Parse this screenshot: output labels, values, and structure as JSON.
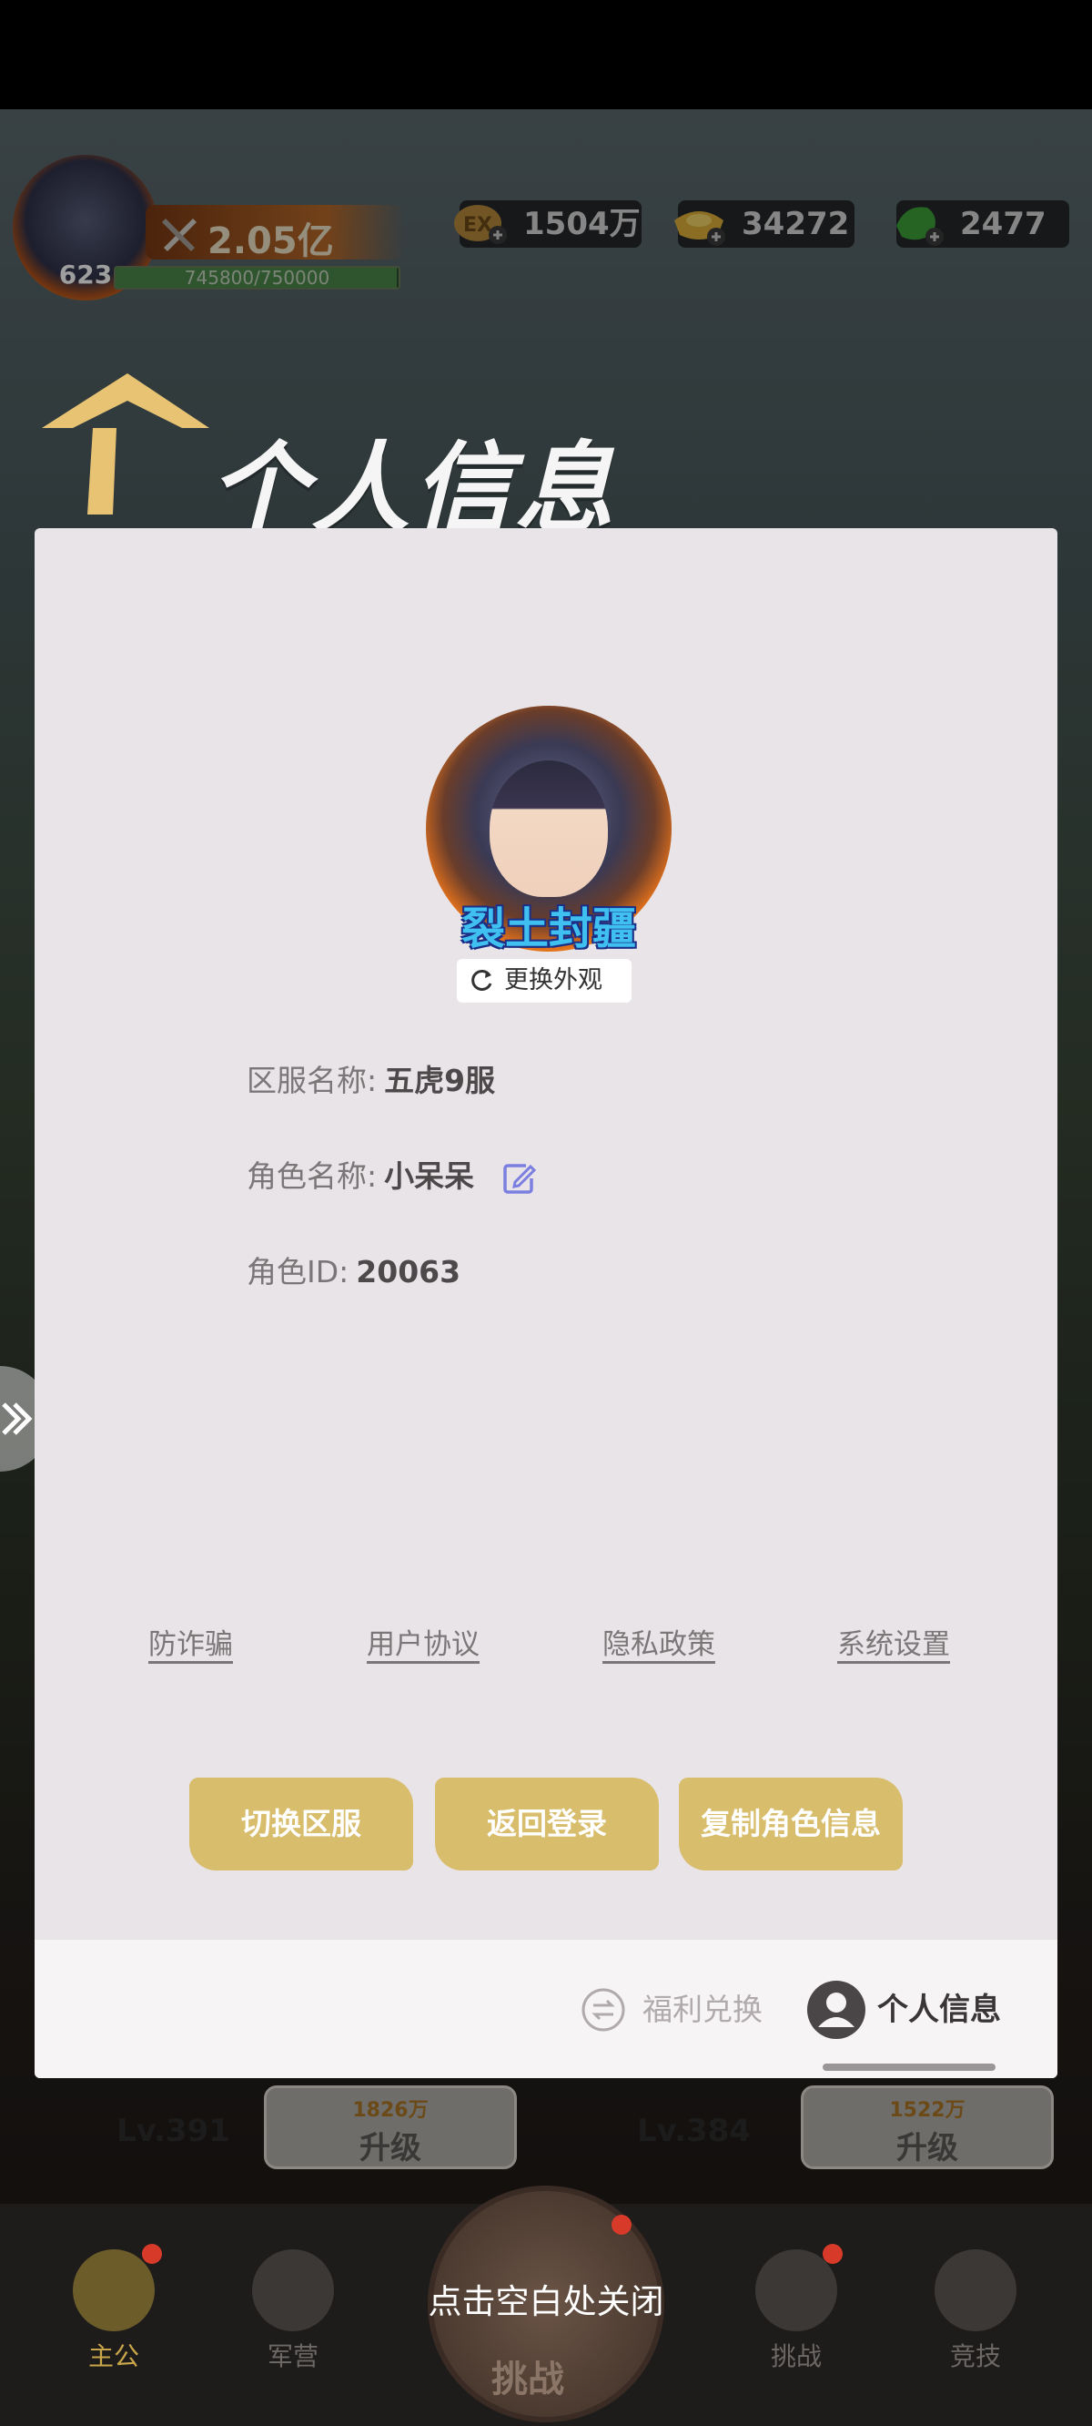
{
  "hud": {
    "player_level": "623",
    "power": "2.05亿",
    "exp_text": "745800/750000",
    "exp_fraction": 0.9944,
    "resources": [
      {
        "icon": "exp-coin-icon",
        "value": "1504万"
      },
      {
        "icon": "gold-ingot-icon",
        "value": "34272"
      },
      {
        "icon": "jade-icon",
        "value": "2477"
      }
    ]
  },
  "page_title": "个人信息",
  "profile": {
    "avatar_title": "裂土封疆",
    "change_skin_label": "更换外观",
    "server_label": "区服名称:",
    "server_value": "五虎9服",
    "role_name_label": "角色名称:",
    "role_name_value": "小呆呆",
    "role_id_label": "角色ID:",
    "role_id_value": "20063"
  },
  "links": {
    "anti_fraud": "防诈骗",
    "user_agreement": "用户协议",
    "privacy_policy": "隐私政策",
    "system_settings": "系统设置"
  },
  "buttons": {
    "switch_server": "切换区服",
    "back_to_login": "返回登录",
    "copy_role_info": "复制角色信息"
  },
  "tabs": {
    "welfare_exchange": "福利兑换",
    "personal_info": "个人信息"
  },
  "background": {
    "hero_cards": [
      {
        "level": "Lv.391",
        "upgrade_cost": "1826万",
        "upgrade_label": "升级"
      },
      {
        "level": "Lv.384",
        "upgrade_cost": "1522万",
        "upgrade_label": "升级"
      }
    ],
    "nav": [
      "主公",
      "军营",
      "挑战",
      "挑战",
      "竞技"
    ]
  },
  "close_hint": "点击空白处关闭",
  "colors": {
    "panel_bg": "#e9e4e7",
    "button_gold": "#d8bd6c",
    "edit_icon_blue": "#7b7fe0"
  }
}
